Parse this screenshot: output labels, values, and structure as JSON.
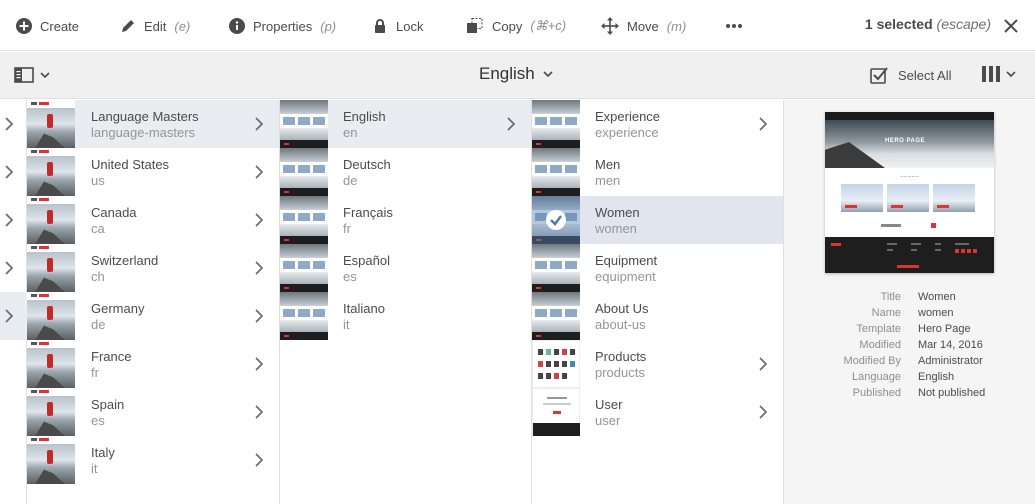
{
  "actionbar": {
    "actions": [
      {
        "label": "Create",
        "shortcut": "",
        "icon": "plus-circle-icon"
      },
      {
        "label": "Edit",
        "shortcut": "(e)",
        "icon": "pencil-icon"
      },
      {
        "label": "Properties",
        "shortcut": "(p)",
        "icon": "info-circle-icon"
      },
      {
        "label": "Lock",
        "shortcut": "",
        "icon": "lock-icon"
      },
      {
        "label": "Copy",
        "shortcut": "(⌘+c)",
        "icon": "copy-icon"
      },
      {
        "label": "Move",
        "shortcut": "(m)",
        "icon": "move-icon"
      }
    ],
    "more_icon": "more-icon",
    "selection_count": "1 selected",
    "selection_shortcut": "(escape)"
  },
  "toolbar": {
    "title": "English",
    "select_all": "Select All"
  },
  "column1": [
    {
      "title": "Language Masters",
      "name": "language-masters"
    },
    {
      "title": "United States",
      "name": "us"
    },
    {
      "title": "Canada",
      "name": "ca"
    },
    {
      "title": "Switzerland",
      "name": "ch"
    },
    {
      "title": "Germany",
      "name": "de"
    },
    {
      "title": "France",
      "name": "fr"
    },
    {
      "title": "Spain",
      "name": "es"
    },
    {
      "title": "Italy",
      "name": "it"
    }
  ],
  "column2": [
    {
      "title": "English",
      "name": "en"
    },
    {
      "title": "Deutsch",
      "name": "de"
    },
    {
      "title": "Français",
      "name": "fr"
    },
    {
      "title": "Español",
      "name": "es"
    },
    {
      "title": "Italiano",
      "name": "it"
    }
  ],
  "column3": [
    {
      "title": "Experience",
      "name": "experience"
    },
    {
      "title": "Men",
      "name": "men"
    },
    {
      "title": "Women",
      "name": "women"
    },
    {
      "title": "Equipment",
      "name": "equipment"
    },
    {
      "title": "About Us",
      "name": "about-us"
    },
    {
      "title": "Products",
      "name": "products"
    },
    {
      "title": "User",
      "name": "user"
    }
  ],
  "preview": {
    "hero_text": "HERO PAGE",
    "properties": [
      {
        "key": "Title",
        "value": "Women"
      },
      {
        "key": "Name",
        "value": "women"
      },
      {
        "key": "Template",
        "value": "Hero Page"
      },
      {
        "key": "Modified",
        "value": "Mar 14, 2016"
      },
      {
        "key": "Modified By",
        "value": "Administrator"
      },
      {
        "key": "Language",
        "value": "English"
      },
      {
        "key": "Published",
        "value": "Not published"
      }
    ]
  }
}
